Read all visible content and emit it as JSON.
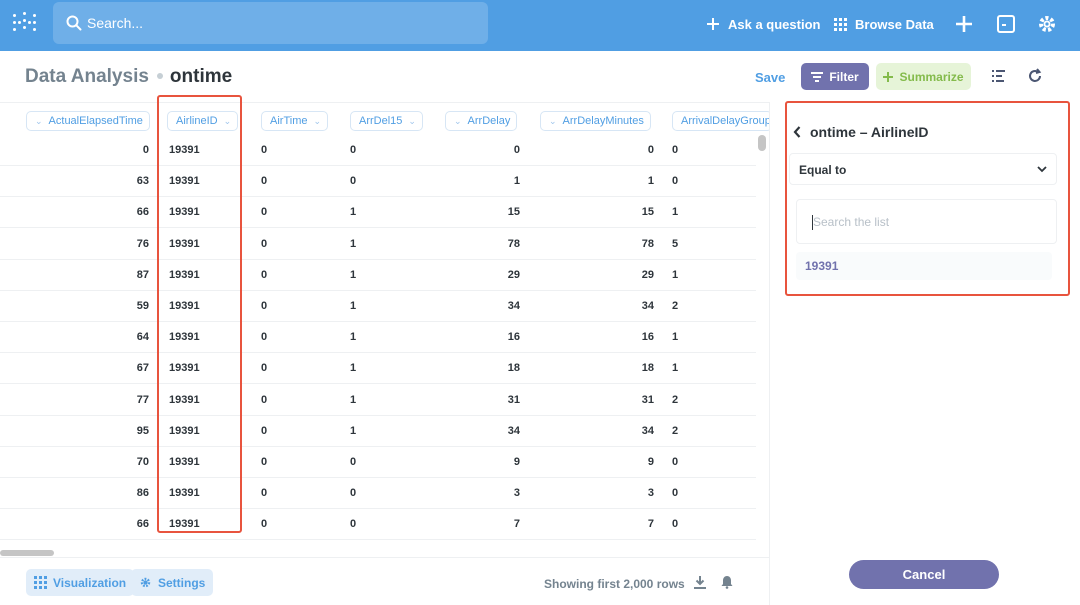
{
  "nav": {
    "search_placeholder": "Search...",
    "ask_question": "Ask a question",
    "browse_data": "Browse Data"
  },
  "header": {
    "database": "Data Analysis",
    "table": "ontime",
    "save": "Save",
    "filter": "Filter",
    "summarize": "Summarize"
  },
  "columns": [
    "ActualElapsedTime",
    "AirlineID",
    "AirTime",
    "ArrDel15",
    "ArrDelay",
    "ArrDelayMinutes",
    "ArrivalDelayGroups"
  ],
  "rows": [
    [
      "0",
      "19391",
      "0",
      "0",
      "0",
      "0",
      "0"
    ],
    [
      "63",
      "19391",
      "0",
      "0",
      "1",
      "1",
      "0"
    ],
    [
      "66",
      "19391",
      "0",
      "1",
      "15",
      "15",
      "1"
    ],
    [
      "76",
      "19391",
      "0",
      "1",
      "78",
      "78",
      "5"
    ],
    [
      "87",
      "19391",
      "0",
      "1",
      "29",
      "29",
      "1"
    ],
    [
      "59",
      "19391",
      "0",
      "1",
      "34",
      "34",
      "2"
    ],
    [
      "64",
      "19391",
      "0",
      "1",
      "16",
      "16",
      "1"
    ],
    [
      "67",
      "19391",
      "0",
      "1",
      "18",
      "18",
      "1"
    ],
    [
      "77",
      "19391",
      "0",
      "1",
      "31",
      "31",
      "2"
    ],
    [
      "95",
      "19391",
      "0",
      "1",
      "34",
      "34",
      "2"
    ],
    [
      "70",
      "19391",
      "0",
      "0",
      "9",
      "9",
      "0"
    ],
    [
      "86",
      "19391",
      "0",
      "0",
      "3",
      "3",
      "0"
    ],
    [
      "66",
      "19391",
      "0",
      "0",
      "7",
      "7",
      "0"
    ]
  ],
  "footer": {
    "visualization": "Visualization",
    "settings": "Settings",
    "row_count": "Showing first 2,000 rows"
  },
  "filter_panel": {
    "title": "ontime – AirlineID",
    "operator": "Equal to",
    "search_placeholder": "Search the list",
    "values": [
      "19391"
    ],
    "cancel": "Cancel"
  },
  "colors": {
    "brand": "#509ee3",
    "filter": "#7172ad",
    "summarize": "#84bb4c",
    "highlight": "#e8543e"
  }
}
